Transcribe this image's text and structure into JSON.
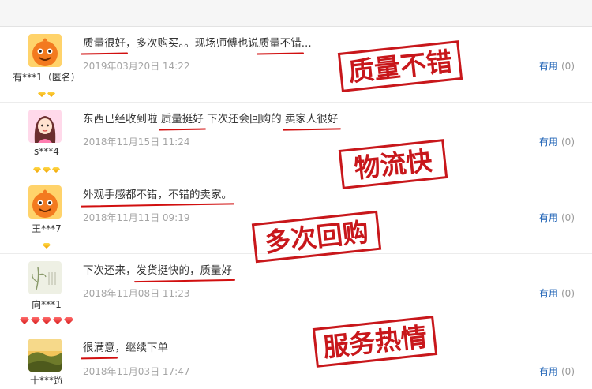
{
  "reviews": [
    {
      "avatar": "orange-mascot-avatar",
      "username": "有***1（匿名）",
      "level_gems": 2,
      "level_color": "#f0a300",
      "content_parts": [
        {
          "text": "质量很好",
          "highlight": true
        },
        {
          "text": "，多次购买。。现场师傅也说",
          "highlight": false
        },
        {
          "text": "质量不错",
          "highlight": true
        },
        {
          "text": "...",
          "highlight": false
        }
      ],
      "date": "2019年03月20日 14:22",
      "useful_label": "有用",
      "useful_count": "(0)",
      "stamp": "质量不错"
    },
    {
      "avatar": "girl-avatar",
      "username": "s***4",
      "level_gems": 3,
      "level_color": "#f0a300",
      "content_parts": [
        {
          "text": "东西已经收到啦 ",
          "highlight": false
        },
        {
          "text": "质量挺好",
          "highlight": true
        },
        {
          "text": " 下次还会回购的 ",
          "highlight": false
        },
        {
          "text": "卖家人很好",
          "highlight": true
        }
      ],
      "date": "2018年11月15日 11:24",
      "useful_label": "有用",
      "useful_count": "(0)",
      "stamp": "物流快"
    },
    {
      "avatar": "orange-mascot-avatar",
      "username": "王***7",
      "level_gems": 1,
      "level_color": "#f0a300",
      "content_parts": [
        {
          "text": "外观手感都不错，不错的卖家。",
          "highlight": true
        }
      ],
      "date": "2018年11月11日 09:19",
      "useful_label": "有用",
      "useful_count": "(0)",
      "stamp": "多次回购"
    },
    {
      "avatar": "plant-sketch-avatar",
      "username": "向***1",
      "level_gems": 5,
      "level_color": "#d71b1b",
      "content_parts": [
        {
          "text": "下次还来，",
          "highlight": false
        },
        {
          "text": "发货挺快的，质量好",
          "highlight": true
        }
      ],
      "date": "2018年11月08日 11:23",
      "useful_label": "有用",
      "useful_count": "(0)",
      "stamp": "服务热情"
    },
    {
      "avatar": "landscape-avatar",
      "username": "十***贸",
      "level_gems": 0,
      "level_color": "#f0a300",
      "content_parts": [
        {
          "text": "很满意",
          "highlight": true
        },
        {
          "text": "，继续下单",
          "highlight": false
        }
      ],
      "date": "2018年11月03日 17:47",
      "useful_label": "有用",
      "useful_count": "(0)",
      "stamp": ""
    }
  ],
  "colors": {
    "stamp_red": "#c8171b",
    "link_blue": "#1a5fb4",
    "date_gray": "#a5a5a5"
  }
}
